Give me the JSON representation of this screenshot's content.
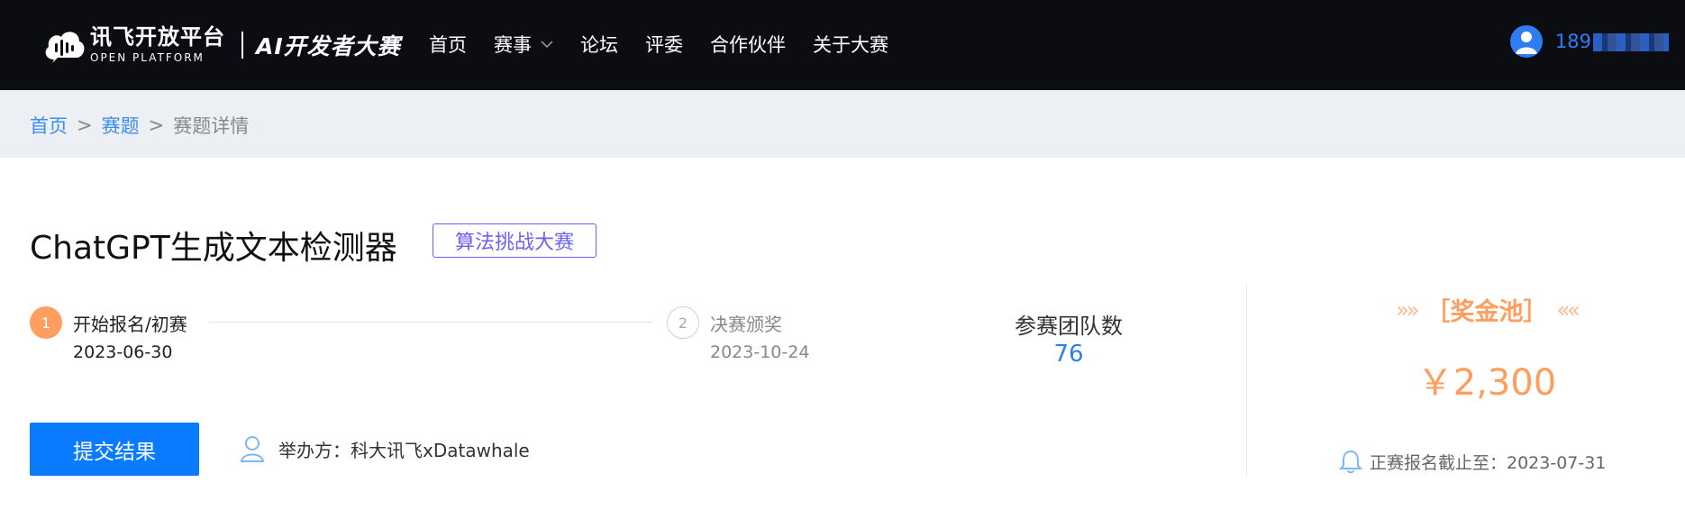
{
  "header": {
    "logo_main": "讯飞开放平台",
    "logo_sub": "OPEN PLATFORM",
    "logo_ai": "AI开发者大赛",
    "nav": [
      {
        "label": "首页"
      },
      {
        "label": "赛事",
        "has_dropdown": true
      },
      {
        "label": "论坛"
      },
      {
        "label": "评委"
      },
      {
        "label": "合作伙伴"
      },
      {
        "label": "关于大赛"
      }
    ],
    "user_name": "189"
  },
  "breadcrumb": {
    "items": [
      "首页",
      "赛题",
      "赛题详情"
    ],
    "separator": ">"
  },
  "competition": {
    "title": "ChatGPT生成文本检测器",
    "tag": "算法挑战大赛",
    "steps": [
      {
        "number": "1",
        "label": "开始报名/初赛",
        "date": "2023-06-30",
        "active": true
      },
      {
        "number": "2",
        "label": "决赛颁奖",
        "date": "2023-10-24",
        "active": false
      }
    ],
    "teams_label": "参赛团队数",
    "teams_count": "76",
    "submit_label": "提交结果",
    "organizer": "举办方：科大讯飞xDatawhale"
  },
  "prize": {
    "arrows_left": "»»",
    "heading": "［奖金池］",
    "arrows_right": "««",
    "amount": "￥2,300",
    "deadline": "正赛报名截止至：2023-07-31"
  },
  "colors": {
    "nav_bg": "#0b0d13",
    "accent_blue": "#0a7bff",
    "link_blue": "#3b8ef0",
    "prize_orange": "#ff9e5e",
    "tag_purple": "#6b63f0"
  }
}
